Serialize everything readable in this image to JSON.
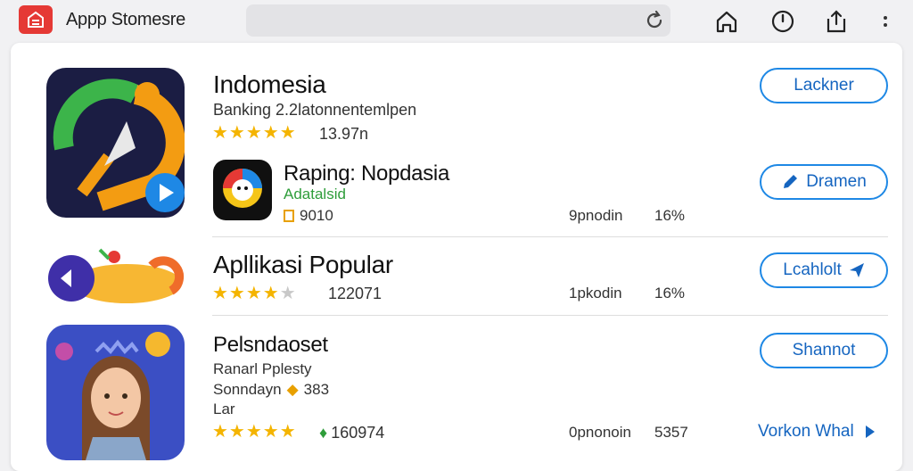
{
  "header": {
    "app_title": "Appp Stomesre"
  },
  "items": [
    {
      "title": "Indomesia",
      "subtitle": "Banking 2.2latonnentemlpen",
      "rating_text": "13.97n",
      "stars": 5,
      "button": "Lackner"
    },
    {
      "title": "Raping: Nopdasia",
      "developer": "Adatalsid",
      "meta1": "9010",
      "meta2": "9pnodin",
      "meta3": "16%",
      "button": "Dramen"
    },
    {
      "title": "Apllikasi Popular",
      "rating_text": "122071",
      "meta2": "1pkodin",
      "meta3": "16%",
      "stars": 4,
      "button": "Lcahlolt"
    },
    {
      "title": "Pelsndaoset",
      "line1": "Ranarl Pplesty",
      "line2": "Sonndayn",
      "line2b": "383",
      "line3": "Lar",
      "rating_text": "160974",
      "meta2": "0pnonoin",
      "meta3": "5357",
      "stars": 5,
      "button": "Shannot",
      "link": "Vorkon Whal"
    }
  ],
  "colors": {
    "accent": "#1e88e5",
    "star": "#f4b400",
    "logo": "#e53935"
  }
}
